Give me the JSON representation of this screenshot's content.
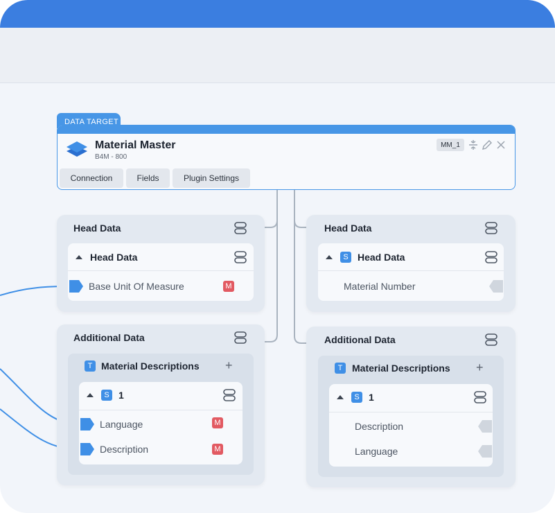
{
  "target": {
    "tab_label": "DATA TARGET",
    "title": "Material Master",
    "subtitle": "B4M - 800",
    "badge": "MM_1",
    "buttons": [
      "Connection",
      "Fields",
      "Plugin Settings"
    ]
  },
  "left": {
    "head_group": {
      "title": "Head Data",
      "section": "Head Data",
      "fields": [
        {
          "label": "Base Unit Of Measure",
          "marker": "M"
        }
      ]
    },
    "additional_group": {
      "title": "Additional Data",
      "table_tag": "T",
      "table": "Material Descriptions",
      "struct_tag": "S",
      "struct": "1",
      "fields": [
        {
          "label": "Language",
          "marker": "M"
        },
        {
          "label": "Description",
          "marker": "M"
        }
      ]
    }
  },
  "right": {
    "head_group": {
      "title": "Head Data",
      "section_tag": "S",
      "section": "Head Data",
      "fields": [
        {
          "label": "Material Number"
        }
      ]
    },
    "additional_group": {
      "title": "Additional Data",
      "table_tag": "T",
      "table": "Material Descriptions",
      "struct_tag": "S",
      "struct": "1",
      "fields": [
        {
          "label": "Description"
        },
        {
          "label": "Language"
        }
      ]
    }
  },
  "colors": {
    "accent": "#3b7ee0",
    "port": "#3f8fe6",
    "mandatory": "#e25a62"
  }
}
